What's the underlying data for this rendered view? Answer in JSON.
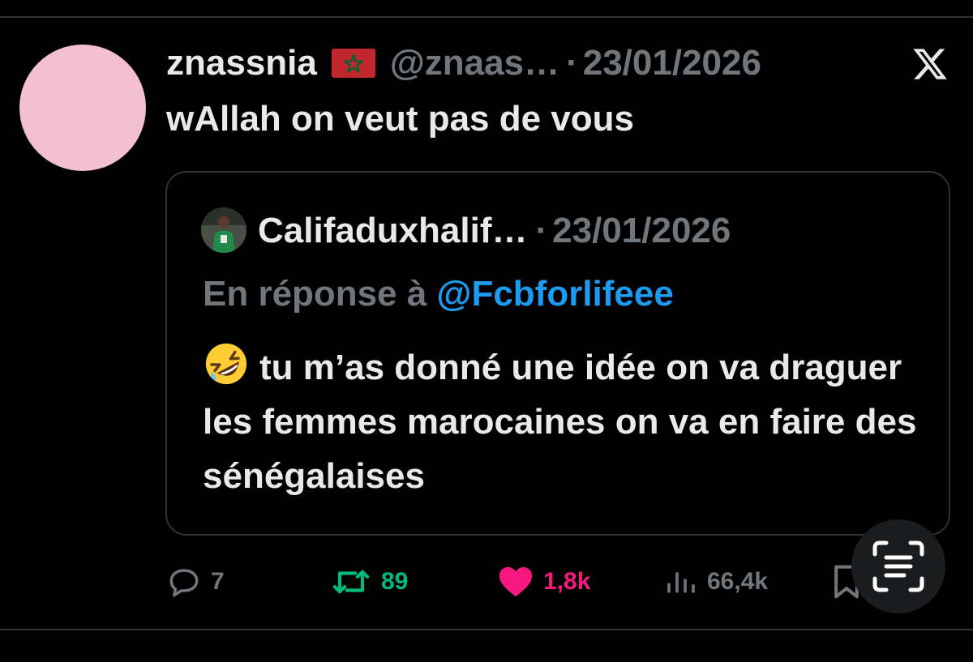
{
  "tweet": {
    "display_name": "znassnia",
    "flag_icon": "morocco-flag-icon",
    "handle": "@znaas…",
    "separator": "·",
    "date": "23/01/2026",
    "text": "wAllah on veut pas de vous",
    "avatar_color": "#f4bfd1"
  },
  "quote": {
    "display_name": "Califaduxhalif…",
    "separator": "·",
    "date": "23/01/2026",
    "reply_prefix": "En réponse à",
    "reply_mention": "@Fcbforlifeee",
    "emoji_icon": "rolling-on-floor-laughing-emoji",
    "text": "tu m’as donné une idée on va draguer les femmes marocaines on va en faire des sénégalaises"
  },
  "actions": {
    "replies": "7",
    "retweets": "89",
    "likes": "1,8k",
    "views": "66,4k"
  },
  "colors": {
    "background": "#000000",
    "text": "#e7e9ea",
    "secondary": "#71767b",
    "link": "#1d9bf0",
    "retweet": "#00ba7c",
    "like": "#f91880"
  }
}
